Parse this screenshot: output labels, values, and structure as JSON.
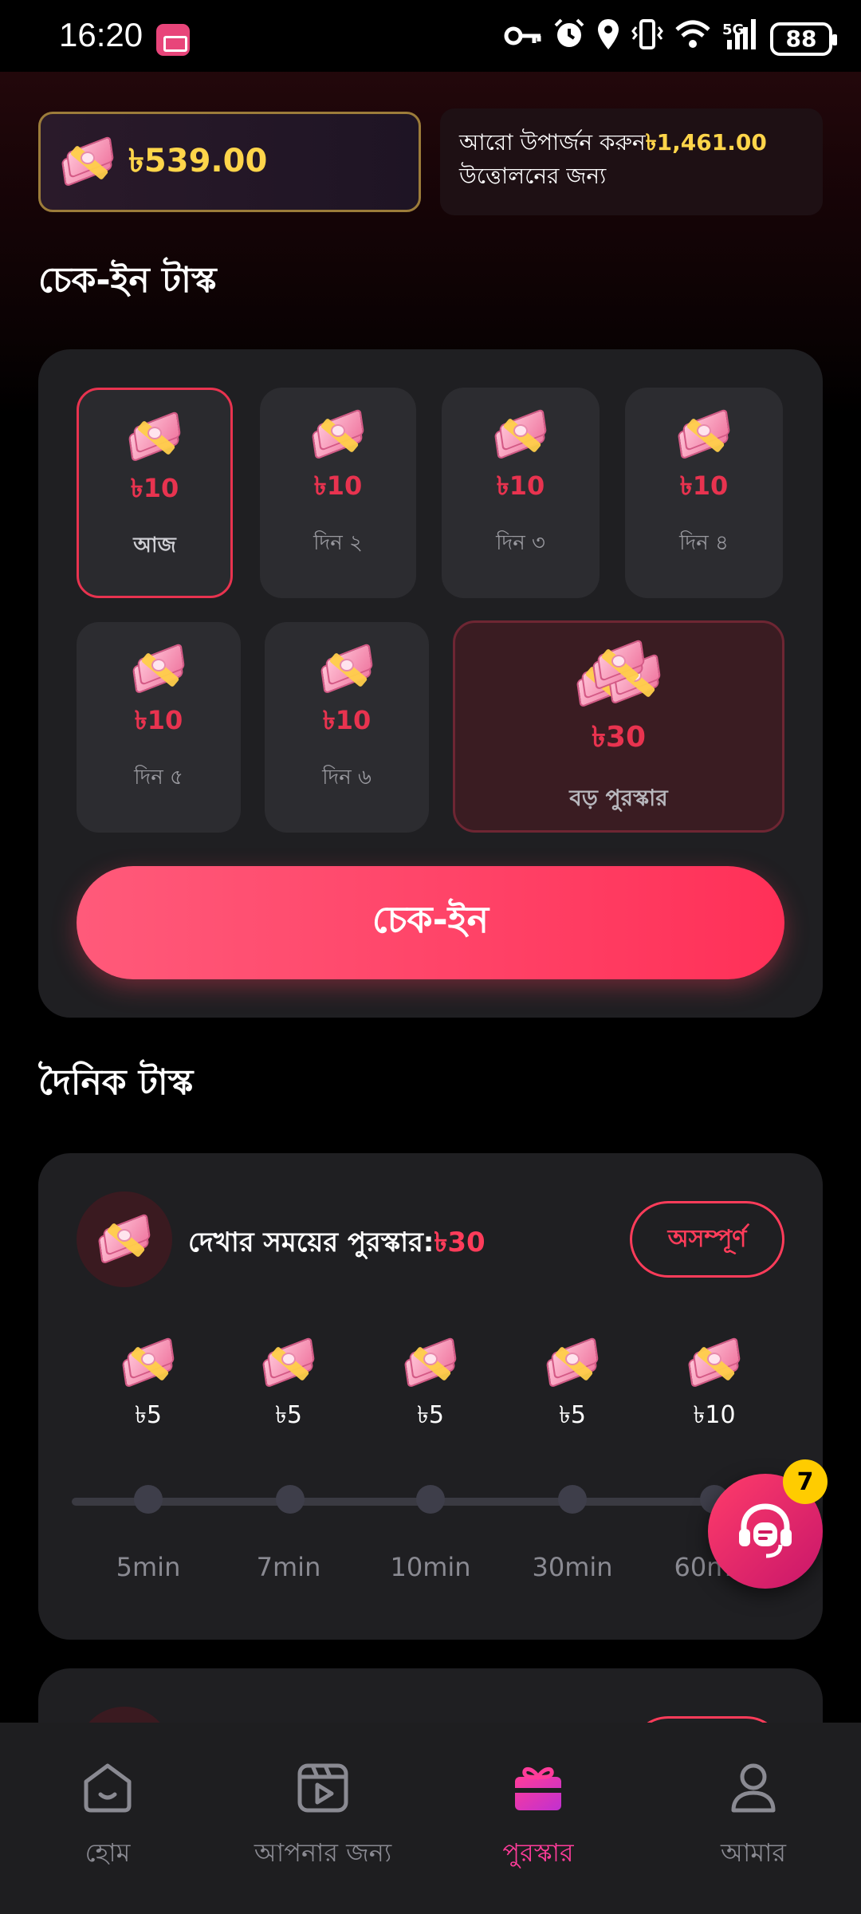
{
  "status_bar": {
    "time": "16:20",
    "network": "5G",
    "battery": "88",
    "icons": [
      "key-icon",
      "alarm-icon",
      "location-icon",
      "vibrate-icon",
      "wifi-icon",
      "signal-icon"
    ]
  },
  "header": {
    "balance": "৳539.00",
    "earn_more_prefix": "আরো উপার্জন করুন",
    "earn_more_amount": "৳1,461.00",
    "earn_more_suffix": "উত্তোলনের জন্য"
  },
  "checkin": {
    "section_title": "চেক-ইন টাস্ক",
    "days": [
      {
        "value": "৳10",
        "label": "আজ"
      },
      {
        "value": "৳10",
        "label": "দিন ২"
      },
      {
        "value": "৳10",
        "label": "দিন ৩"
      },
      {
        "value": "৳10",
        "label": "দিন ৪"
      },
      {
        "value": "৳10",
        "label": "দিন ৫"
      },
      {
        "value": "৳10",
        "label": "দিন ৬"
      }
    ],
    "big_reward": {
      "value": "৳30",
      "label": "বড় পুরস্কার"
    },
    "button_label": "চেক-ইন"
  },
  "daily": {
    "section_title": "দৈনিক টাস্ক",
    "watch_task": {
      "title": "দেখার সময়ের পুরস্কার:",
      "title_amount": "৳30",
      "status": "অসম্পূর্ণ",
      "steps": [
        {
          "value": "৳5",
          "time": "5min"
        },
        {
          "value": "৳5",
          "time": "7min"
        },
        {
          "value": "৳5",
          "time": "10min"
        },
        {
          "value": "৳5",
          "time": "30min"
        },
        {
          "value": "৳10",
          "time": "60min"
        }
      ]
    }
  },
  "support": {
    "badge_count": "7"
  },
  "nav": {
    "items": [
      {
        "label": "হোম",
        "icon": "home-icon"
      },
      {
        "label": "আপনার জন্য",
        "icon": "video-icon"
      },
      {
        "label": "পুরস্কার",
        "icon": "gift-icon"
      },
      {
        "label": "আমার",
        "icon": "profile-icon"
      }
    ],
    "active_index": 2
  },
  "colors": {
    "accent": "#ff3c5a",
    "gold": "#ffd54a",
    "active_nav": "#ff3c9a"
  }
}
